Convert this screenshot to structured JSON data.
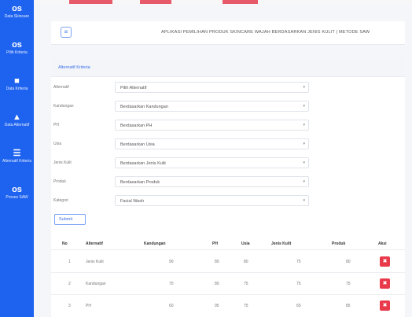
{
  "sidebar": {
    "items": [
      {
        "icon": "os",
        "label": "Data Skincare"
      },
      {
        "icon": "os",
        "label": "Pilih Kriteria"
      },
      {
        "icon": "■",
        "label": "Data Kriteria"
      },
      {
        "icon": "▲",
        "label": "Data Alternatif"
      },
      {
        "icon": "☰",
        "label": "Alternatif Kriteria"
      },
      {
        "icon": "os",
        "label": "Proses SAW"
      }
    ]
  },
  "header": {
    "menu_icon": "≡",
    "title": "APLIKASI PEMILIHAN PRODUK SKINCARE WAJAH BERDASARKAN JENIS KULIT | METODE SAW"
  },
  "card": {
    "title": "Alternatif Kriteria",
    "form": [
      {
        "label": "Alternatif",
        "value": "Pilih Alternatif"
      },
      {
        "label": "Kandungan",
        "value": "Berdasarkan Kandungan"
      },
      {
        "label": "PH",
        "value": "Berdasarkan PH"
      },
      {
        "label": "Usia",
        "value": "Berdasarkan Usia"
      },
      {
        "label": "Jenis Kulit",
        "value": "Berdasarkan Jenis Kulit"
      },
      {
        "label": "Produk",
        "value": "Berdasarkan Produk"
      },
      {
        "label": "Kategori",
        "value": "Facial Wash"
      }
    ],
    "submit_label": "Submit"
  },
  "table": {
    "headers": [
      "No",
      "Alternatif",
      "Kandungan",
      "PH",
      "Usia",
      "Jenis Kulit",
      "Produk",
      "Aksi"
    ],
    "rows": [
      {
        "no": "1",
        "alternatif": "Jenis Kulit",
        "kandungan": "90",
        "ph": "80",
        "usia": "80",
        "jenis_kulit": "75",
        "produk": "80"
      },
      {
        "no": "2",
        "alternatif": "Kandungan",
        "kandungan": "70",
        "ph": "80",
        "usia": "75",
        "jenis_kulit": "75",
        "produk": "75"
      },
      {
        "no": "3",
        "alternatif": "PH",
        "kandungan": "60",
        "ph": "95",
        "usia": "75",
        "jenis_kulit": "65",
        "produk": "85"
      }
    ]
  },
  "colors": {
    "sidebar": "#1e63f0",
    "accent": "#3b6fe8",
    "danger": "#e83a4a"
  }
}
